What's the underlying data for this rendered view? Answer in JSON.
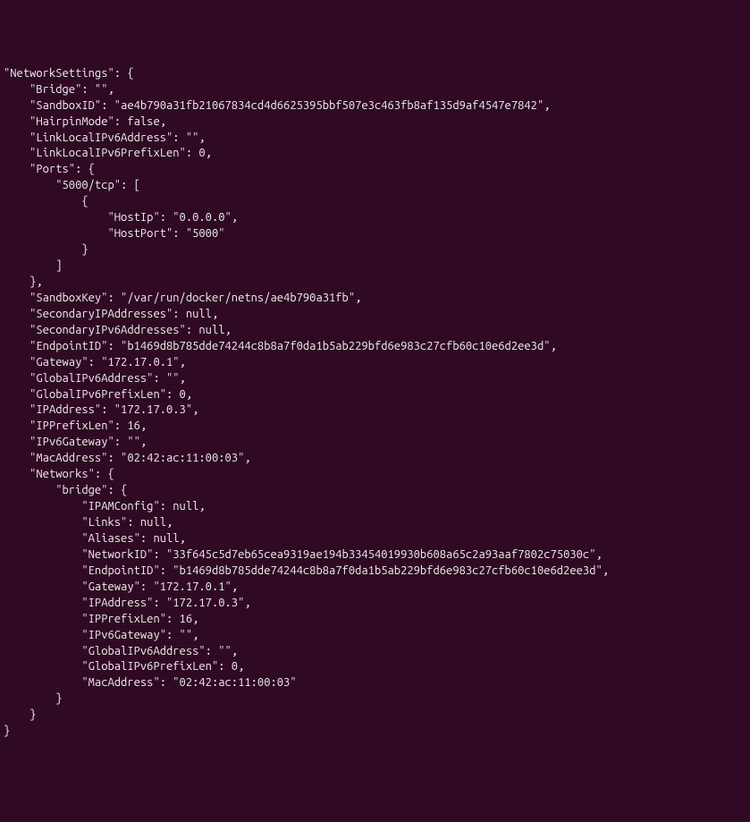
{
  "terminal": {
    "lines": [
      "\"NetworkSettings\": {",
      "    \"Bridge\": \"\",",
      "    \"SandboxID\": \"ae4b790a31fb21067834cd4d6625395bbf507e3c463fb8af135d9af4547e7842\",",
      "    \"HairpinMode\": false,",
      "    \"LinkLocalIPv6Address\": \"\",",
      "    \"LinkLocalIPv6PrefixLen\": 0,",
      "    \"Ports\": {",
      "        \"5000/tcp\": [",
      "            {",
      "                \"HostIp\": \"0.0.0.0\",",
      "                \"HostPort\": \"5000\"",
      "            }",
      "        ]",
      "    },",
      "    \"SandboxKey\": \"/var/run/docker/netns/ae4b790a31fb\",",
      "    \"SecondaryIPAddresses\": null,",
      "    \"SecondaryIPv6Addresses\": null,",
      "    \"EndpointID\": \"b1469d8b785dde74244c8b8a7f0da1b5ab229bfd6e983c27cfb60c10e6d2ee3d\",",
      "    \"Gateway\": \"172.17.0.1\",",
      "    \"GlobalIPv6Address\": \"\",",
      "    \"GlobalIPv6PrefixLen\": 0,",
      "    \"IPAddress\": \"172.17.0.3\",",
      "    \"IPPrefixLen\": 16,",
      "    \"IPv6Gateway\": \"\",",
      "    \"MacAddress\": \"02:42:ac:11:00:03\",",
      "    \"Networks\": {",
      "        \"bridge\": {",
      "            \"IPAMConfig\": null,",
      "            \"Links\": null,",
      "            \"Aliases\": null,",
      "            \"NetworkID\": \"33f645c5d7eb65cea9319ae194b33454019930b608a65c2a93aaf7802c75030c\",",
      "            \"EndpointID\": \"b1469d8b785dde74244c8b8a7f0da1b5ab229bfd6e983c27cfb60c10e6d2ee3d\",",
      "            \"Gateway\": \"172.17.0.1\",",
      "            \"IPAddress\": \"172.17.0.3\",",
      "            \"IPPrefixLen\": 16,",
      "            \"IPv6Gateway\": \"\",",
      "            \"GlobalIPv6Address\": \"\",",
      "            \"GlobalIPv6PrefixLen\": 0,",
      "            \"MacAddress\": \"02:42:ac:11:00:03\"",
      "        }",
      "    }",
      "}"
    ]
  }
}
